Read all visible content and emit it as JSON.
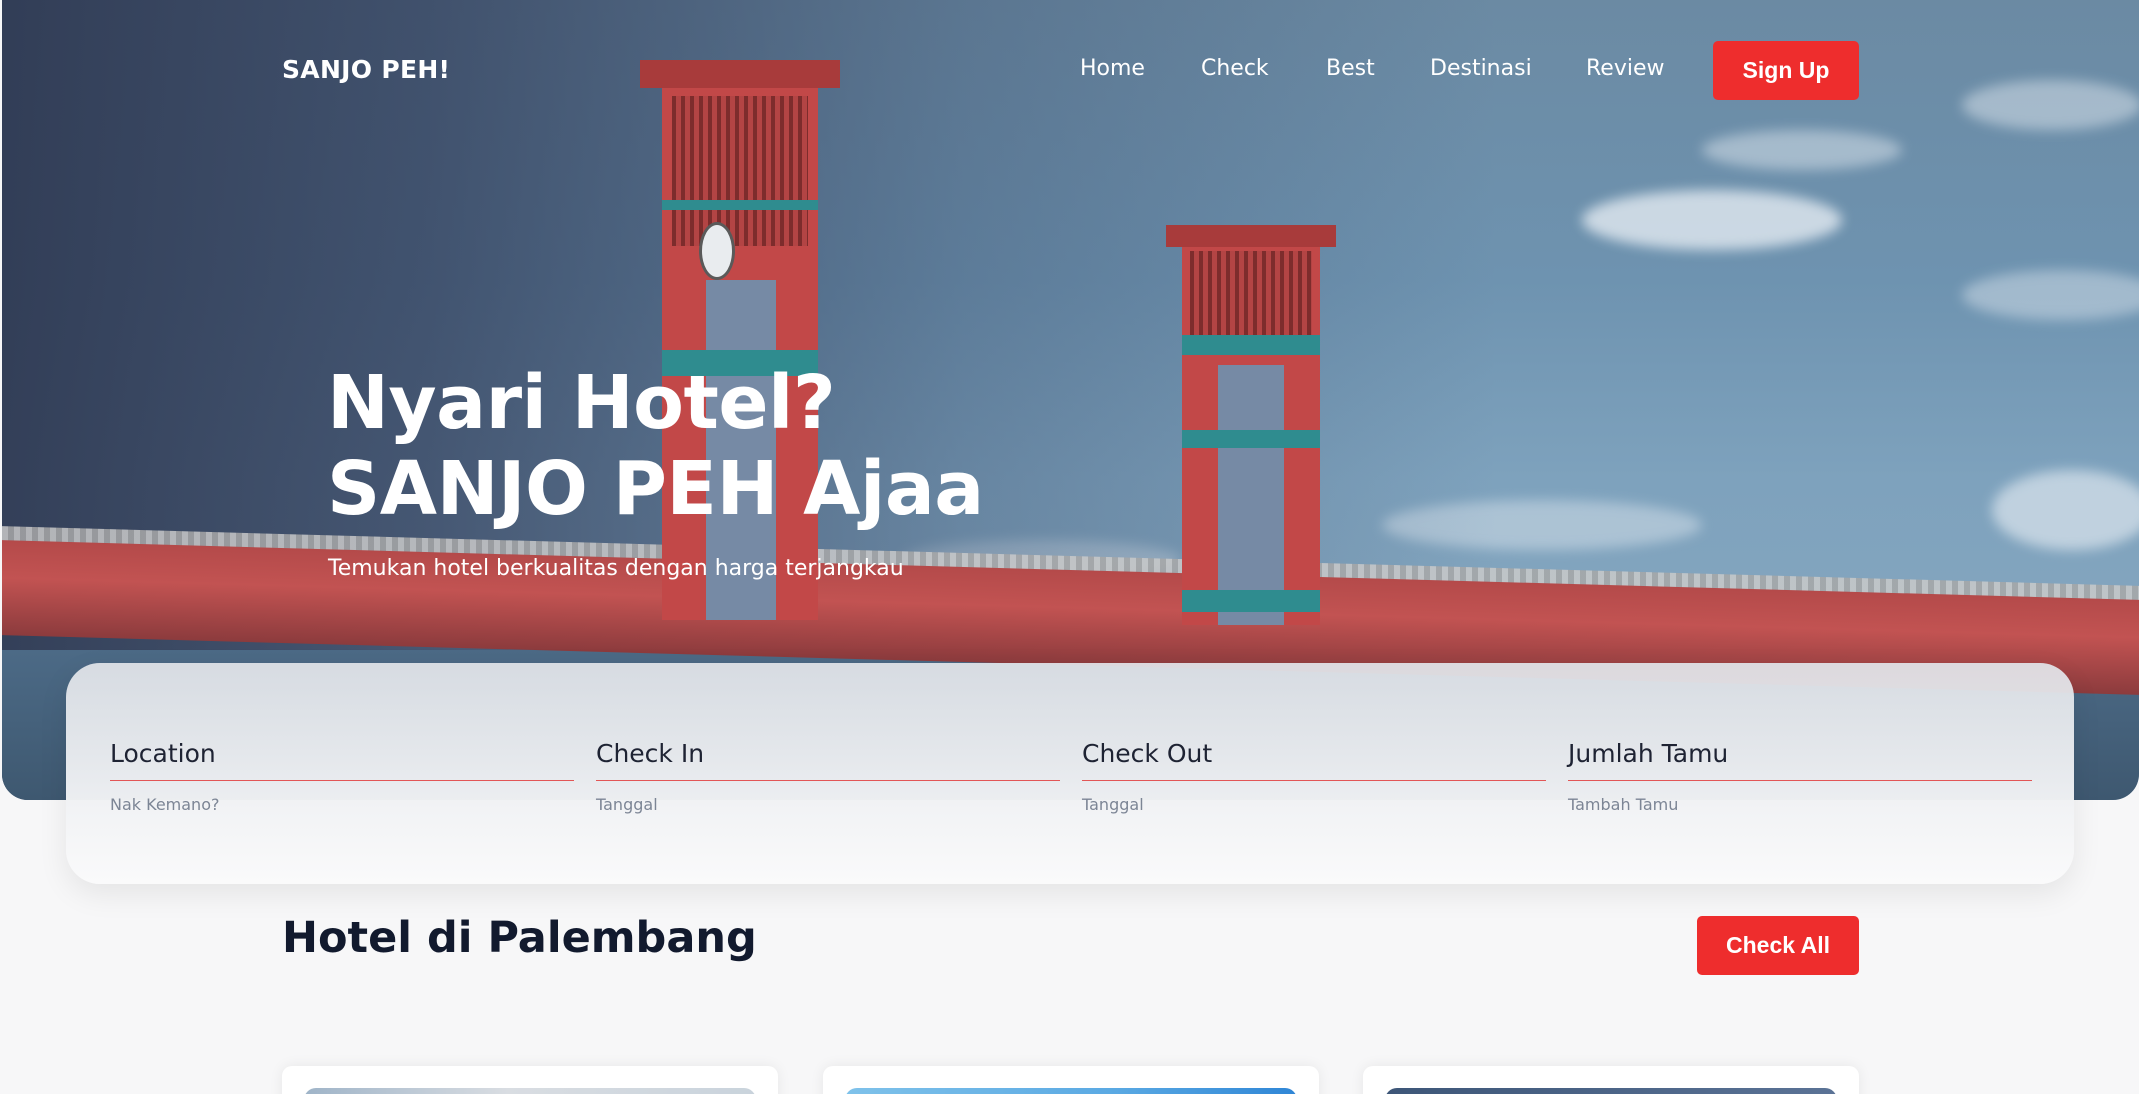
{
  "brand": {
    "name": "SANJO PEH!"
  },
  "nav": {
    "items": [
      {
        "label": "Home"
      },
      {
        "label": "Check"
      },
      {
        "label": "Best"
      },
      {
        "label": "Destinasi"
      },
      {
        "label": "Review"
      }
    ],
    "cta_label": "Sign Up"
  },
  "hero": {
    "title_line1": "Nyari Hotel?",
    "title_line2": "SANJO PEH Ajaa",
    "subtitle": "Temukan hotel berkualitas dengan harga terjangkau"
  },
  "search": {
    "fields": [
      {
        "label": "Location",
        "placeholder": "Nak Kemano?"
      },
      {
        "label": "Check In",
        "placeholder": "Tanggal"
      },
      {
        "label": "Check Out",
        "placeholder": "Tanggal"
      },
      {
        "label": "Jumlah Tamu",
        "placeholder": "Tambah Tamu"
      }
    ]
  },
  "section": {
    "title": "Hotel di Palembang",
    "action_label": "Check All"
  },
  "colors": {
    "accent": "#ee2d2d",
    "heading": "#121a2e",
    "background": "#f7f7f8"
  }
}
